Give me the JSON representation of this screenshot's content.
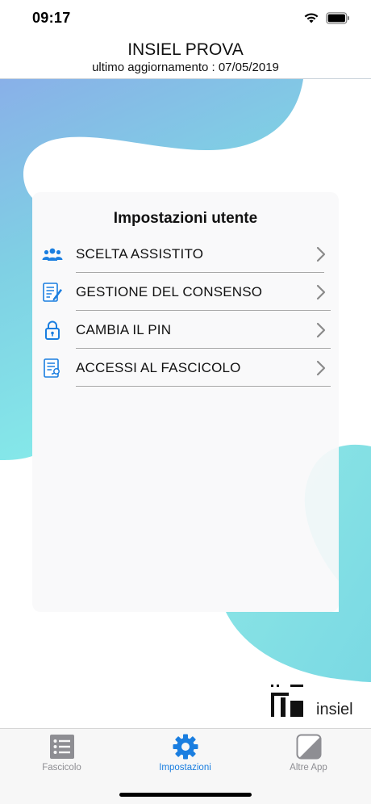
{
  "status_bar": {
    "time": "09:17"
  },
  "header": {
    "title": "INSIEL PROVA",
    "subtitle": "ultimo aggiornamento : 07/05/2019"
  },
  "settings": {
    "title": "Impostazioni utente",
    "items": [
      {
        "label": "SCELTA ASSISTITO",
        "icon": "people-icon"
      },
      {
        "label": "GESTIONE DEL CONSENSO",
        "icon": "document-edit-icon"
      },
      {
        "label": "CAMBIA IL PIN",
        "icon": "lock-icon"
      },
      {
        "label": "ACCESSI AL FASCICOLO",
        "icon": "document-access-icon"
      }
    ]
  },
  "logo": {
    "text": "insiel"
  },
  "tab_bar": {
    "tabs": [
      {
        "label": "Fascicolo",
        "icon": "list-icon",
        "active": false
      },
      {
        "label": "Impostazioni",
        "icon": "gear-icon",
        "active": true
      },
      {
        "label": "Altre App",
        "icon": "apps-icon",
        "active": false
      }
    ]
  },
  "colors": {
    "accent": "#1a7ee0",
    "background_gradient_top": "#88b6e6",
    "background_gradient_bottom": "#7fe3e3"
  }
}
